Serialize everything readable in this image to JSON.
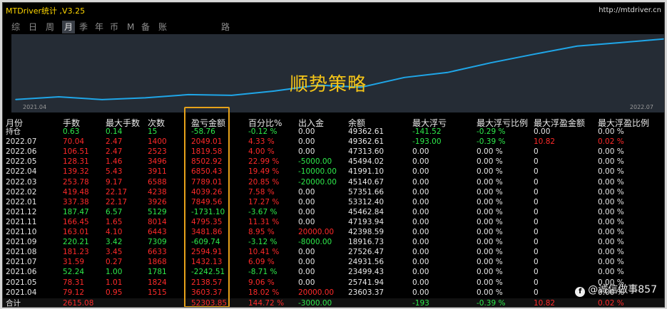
{
  "window": {
    "title": "MTDriver统计 ,V3.25",
    "url": "http://mtdriver.cn"
  },
  "tabs": [
    {
      "label": "综",
      "active": false
    },
    {
      "label": "日",
      "active": false
    },
    {
      "label": "周",
      "active": false
    },
    {
      "label": "月",
      "active": true
    },
    {
      "label": "季",
      "active": false
    },
    {
      "label": "年",
      "active": false
    },
    {
      "label": "币",
      "active": false
    },
    {
      "label": "M",
      "active": false
    },
    {
      "label": "备",
      "active": false
    },
    {
      "label": "账户",
      "active": false
    },
    {
      "label": "路径",
      "active": false
    }
  ],
  "chart": {
    "label": "顺势策略",
    "x_start": "2021.04",
    "x_end": "2022.07",
    "line_color": "#1fa6e8",
    "bg_color": "#252c35"
  },
  "chart_data": {
    "type": "line",
    "categories": [
      "2021.04",
      "2021.05",
      "2021.06",
      "2021.07",
      "2021.08",
      "2021.09",
      "2021.10",
      "2021.11",
      "2021.12",
      "2022.01",
      "2022.02",
      "2022.03",
      "2022.04",
      "2022.05",
      "2022.06",
      "2022.07"
    ],
    "values": [
      3603.37,
      5742,
      3500,
      4932,
      7527,
      6918,
      10400,
      15185,
      13454,
      21300,
      25351,
      33140,
      39991,
      46494,
      49313,
      52303.85
    ],
    "title": "",
    "xlabel": "",
    "ylabel": "",
    "ylim": [
      0,
      55000
    ],
    "grid": false
  },
  "table": {
    "headers": [
      "月份",
      "手数",
      "最大手数",
      "次数",
      "盈亏金额",
      "百分比%",
      "出入金",
      "余额",
      "最大浮亏",
      "最大浮亏比例",
      "最大浮盈金额",
      "最大浮盈比例"
    ],
    "rows": [
      {
        "c": [
          "持仓",
          "0.63",
          "0.14",
          "15",
          "-58.76",
          "-0.12 %",
          "0.00",
          "49362.61",
          "-141.52",
          "-0.29 %",
          "0.00",
          "0.00 %"
        ],
        "k": [
          "w",
          "g",
          "g",
          "g",
          "g",
          "g",
          "w",
          "w",
          "g",
          "g",
          "w",
          "w"
        ]
      },
      {
        "c": [
          "2022.07",
          "70.04",
          "2.47",
          "1400",
          "2049.01",
          "4.33 %",
          "0.00",
          "49362.61",
          "-193.00",
          "-0.39 %",
          "10.82",
          "0.02 %"
        ],
        "k": [
          "w",
          "r",
          "r",
          "r",
          "r",
          "r",
          "w",
          "w",
          "g",
          "g",
          "r",
          "r"
        ]
      },
      {
        "c": [
          "2022.06",
          "106.51",
          "2.47",
          "2523",
          "1819.58",
          "4.00 %",
          "0.00",
          "47313.60",
          "0.00",
          "0.00 %",
          "0",
          "0.00 %"
        ],
        "k": [
          "w",
          "r",
          "r",
          "r",
          "r",
          "r",
          "w",
          "w",
          "w",
          "w",
          "w",
          "w"
        ]
      },
      {
        "c": [
          "2022.05",
          "128.31",
          "1.46",
          "3496",
          "8502.92",
          "22.99 %",
          "-5000.00",
          "45494.02",
          "0.00",
          "0.00 %",
          "0",
          "0.00 %"
        ],
        "k": [
          "w",
          "r",
          "r",
          "r",
          "r",
          "r",
          "g",
          "w",
          "w",
          "w",
          "w",
          "w"
        ]
      },
      {
        "c": [
          "2022.04",
          "139.32",
          "5.43",
          "3911",
          "6850.43",
          "19.49 %",
          "-10000.00",
          "41991.10",
          "0.00",
          "0.00 %",
          "0",
          "0.00 %"
        ],
        "k": [
          "w",
          "r",
          "r",
          "r",
          "r",
          "r",
          "g",
          "w",
          "w",
          "w",
          "w",
          "w"
        ]
      },
      {
        "c": [
          "2022.03",
          "253.78",
          "9.17",
          "6588",
          "7789.01",
          "20.85 %",
          "-20000.00",
          "45140.67",
          "0.00",
          "0.00 %",
          "0",
          "0.00 %"
        ],
        "k": [
          "w",
          "r",
          "r",
          "r",
          "r",
          "r",
          "g",
          "w",
          "w",
          "w",
          "w",
          "w"
        ]
      },
      {
        "c": [
          "2022.02",
          "419.48",
          "22.17",
          "4238",
          "4039.26",
          "7.58 %",
          "0.00",
          "57351.66",
          "0.00",
          "0.00 %",
          "0",
          "0.00 %"
        ],
        "k": [
          "w",
          "r",
          "r",
          "r",
          "r",
          "r",
          "w",
          "w",
          "w",
          "w",
          "w",
          "w"
        ]
      },
      {
        "c": [
          "2022.01",
          "337.38",
          "22.17",
          "3926",
          "7849.56",
          "17.27 %",
          "0.00",
          "53312.40",
          "0.00",
          "0.00 %",
          "0",
          "0.00 %"
        ],
        "k": [
          "w",
          "r",
          "r",
          "r",
          "r",
          "r",
          "w",
          "w",
          "w",
          "w",
          "w",
          "w"
        ]
      },
      {
        "c": [
          "2021.12",
          "187.47",
          "6.57",
          "5129",
          "-1731.10",
          "-3.67 %",
          "0.00",
          "45462.84",
          "0.00",
          "0.00 %",
          "0",
          "0.00 %"
        ],
        "k": [
          "w",
          "g",
          "g",
          "g",
          "g",
          "g",
          "w",
          "w",
          "w",
          "w",
          "w",
          "w"
        ]
      },
      {
        "c": [
          "2021.11",
          "166.45",
          "1.65",
          "8014",
          "4795.35",
          "11.31 %",
          "0.00",
          "47193.94",
          "0.00",
          "0.00 %",
          "0",
          "0.00 %"
        ],
        "k": [
          "w",
          "r",
          "r",
          "r",
          "r",
          "r",
          "w",
          "w",
          "w",
          "w",
          "w",
          "w"
        ]
      },
      {
        "c": [
          "2021.10",
          "163.01",
          "4.10",
          "6443",
          "3481.86",
          "8.95 %",
          "20000.00",
          "42398.59",
          "0.00",
          "0.00 %",
          "0",
          "0.00 %"
        ],
        "k": [
          "w",
          "r",
          "r",
          "r",
          "r",
          "r",
          "r",
          "w",
          "w",
          "w",
          "w",
          "w"
        ]
      },
      {
        "c": [
          "2021.09",
          "220.21",
          "3.42",
          "7309",
          "-609.74",
          "-3.12 %",
          "-8000.00",
          "18916.73",
          "0.00",
          "0.00 %",
          "0",
          "0.00 %"
        ],
        "k": [
          "w",
          "g",
          "g",
          "g",
          "g",
          "g",
          "g",
          "w",
          "w",
          "w",
          "w",
          "w"
        ]
      },
      {
        "c": [
          "2021.08",
          "181.23",
          "3.45",
          "6633",
          "2594.91",
          "10.41 %",
          "0.00",
          "27526.47",
          "0.00",
          "0.00 %",
          "0",
          "0.00 %"
        ],
        "k": [
          "w",
          "r",
          "r",
          "r",
          "r",
          "r",
          "w",
          "w",
          "w",
          "w",
          "w",
          "w"
        ]
      },
      {
        "c": [
          "2021.07",
          "31.59",
          "0.27",
          "1868",
          "1432.13",
          "6.09 %",
          "0.00",
          "24931.56",
          "0.00",
          "0.00 %",
          "0",
          "0.00 %"
        ],
        "k": [
          "w",
          "r",
          "r",
          "r",
          "r",
          "r",
          "w",
          "w",
          "w",
          "w",
          "w",
          "w"
        ]
      },
      {
        "c": [
          "2021.06",
          "52.24",
          "1.00",
          "1781",
          "-2242.51",
          "-8.71 %",
          "0.00",
          "23499.43",
          "0.00",
          "0.00 %",
          "0",
          "0.00 %"
        ],
        "k": [
          "w",
          "g",
          "g",
          "g",
          "g",
          "g",
          "w",
          "w",
          "w",
          "w",
          "w",
          "w"
        ]
      },
      {
        "c": [
          "2021.05",
          "78.31",
          "1.01",
          "1824",
          "2138.57",
          "9.06 %",
          "0.00",
          "25741.94",
          "0.00",
          "0.00 %",
          "0",
          "0.00 %"
        ],
        "k": [
          "w",
          "r",
          "r",
          "r",
          "r",
          "r",
          "w",
          "w",
          "w",
          "w",
          "w",
          "w"
        ]
      },
      {
        "c": [
          "2021.04",
          "79.12",
          "0.95",
          "1515",
          "3603.37",
          "18.02 %",
          "20000.00",
          "23603.37",
          "0.00",
          "0.00 %",
          "0",
          "0.00 %"
        ],
        "k": [
          "w",
          "r",
          "r",
          "r",
          "r",
          "r",
          "r",
          "w",
          "w",
          "w",
          "w",
          "w"
        ]
      }
    ],
    "total": {
      "c": [
        "合计",
        "2615.08",
        "",
        "",
        "52303.85",
        "144.72 %",
        "-3000.00",
        "",
        "-193",
        "-0.39 %",
        "10.82",
        "0.02 %"
      ],
      "k": [
        "w",
        "r",
        "w",
        "w",
        "r",
        "r",
        "g",
        "w",
        "g",
        "g",
        "r",
        "r"
      ]
    }
  },
  "watermark": "@诚信做事857"
}
